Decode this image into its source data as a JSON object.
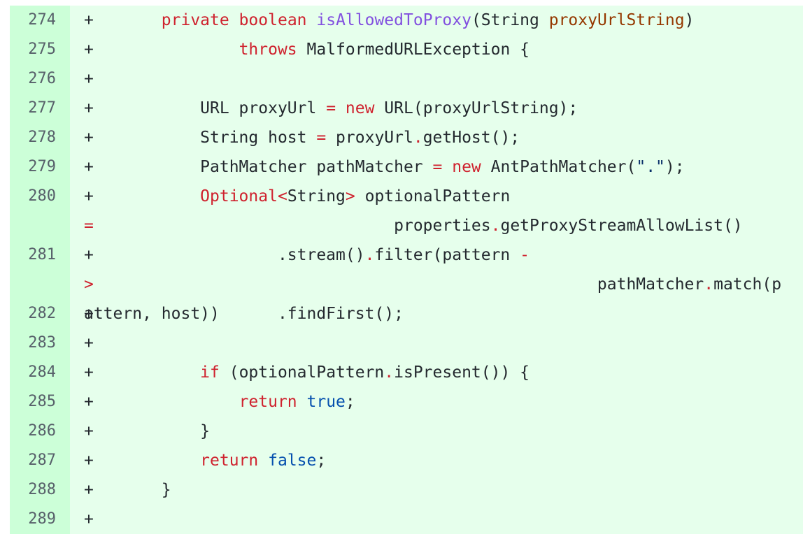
{
  "diff": {
    "marker": "+",
    "colors": {
      "added_bg": "#e6ffec",
      "added_gutter_bg": "#ccffd8",
      "keyword": "#cf222e",
      "function": "#8250df",
      "parameter": "#953800",
      "constant": "#0550ae",
      "string": "#0a3069"
    },
    "lines": [
      {
        "num": "274",
        "tokens": [
          {
            "t": "      ",
            "c": ""
          },
          {
            "t": "private",
            "c": "kw"
          },
          {
            "t": " ",
            "c": ""
          },
          {
            "t": "boolean",
            "c": "kw"
          },
          {
            "t": " ",
            "c": ""
          },
          {
            "t": "isAllowedToProxy",
            "c": "fn"
          },
          {
            "t": "(String ",
            "c": ""
          },
          {
            "t": "proxyUrlString",
            "c": "param"
          },
          {
            "t": ")",
            "c": ""
          }
        ]
      },
      {
        "num": "275",
        "tokens": [
          {
            "t": "              ",
            "c": ""
          },
          {
            "t": "throws",
            "c": "kw"
          },
          {
            "t": " MalformedURLException {",
            "c": ""
          }
        ]
      },
      {
        "num": "276",
        "tokens": []
      },
      {
        "num": "277",
        "tokens": [
          {
            "t": "          URL proxyUrl ",
            "c": ""
          },
          {
            "t": "=",
            "c": "op"
          },
          {
            "t": " ",
            "c": ""
          },
          {
            "t": "new",
            "c": "kw"
          },
          {
            "t": " URL(proxyUrlString);",
            "c": ""
          }
        ]
      },
      {
        "num": "278",
        "tokens": [
          {
            "t": "          String host ",
            "c": ""
          },
          {
            "t": "=",
            "c": "op"
          },
          {
            "t": " proxyUrl",
            "c": ""
          },
          {
            "t": ".",
            "c": "op"
          },
          {
            "t": "getHost();",
            "c": ""
          }
        ]
      },
      {
        "num": "279",
        "tokens": [
          {
            "t": "          PathMatcher pathMatcher ",
            "c": ""
          },
          {
            "t": "=",
            "c": "op"
          },
          {
            "t": " ",
            "c": ""
          },
          {
            "t": "new",
            "c": "kw"
          },
          {
            "t": " AntPathMatcher(",
            "c": ""
          },
          {
            "t": "\".\"",
            "c": "str"
          },
          {
            "t": ");",
            "c": ""
          }
        ]
      },
      {
        "num": "280",
        "wrap": true,
        "tokens": [
          {
            "t": "          ",
            "c": ""
          },
          {
            "t": "Optional",
            "c": "kw"
          },
          {
            "t": "<",
            "c": "op"
          },
          {
            "t": "String",
            "c": ""
          },
          {
            "t": ">",
            "c": "op"
          },
          {
            "t": " optionalPattern ",
            "c": ""
          },
          {
            "t": "=",
            "c": "op"
          },
          {
            "t": "                               ",
            "c": ""
          },
          {
            "t": "properties",
            "c": ""
          },
          {
            "t": ".",
            "c": "op"
          },
          {
            "t": "getProxyStreamAllowList()",
            "c": ""
          }
        ]
      },
      {
        "num": "281",
        "wrap": true,
        "tokens": [
          {
            "t": "                  .stream()",
            "c": ""
          },
          {
            "t": ".",
            "c": "op"
          },
          {
            "t": "filter(pattern ",
            "c": ""
          },
          {
            "t": "->",
            "c": "op"
          },
          {
            "t": "                                                    ",
            "c": ""
          },
          {
            "t": "pathMatcher",
            "c": ""
          },
          {
            "t": ".",
            "c": "op"
          },
          {
            "t": "match(pattern, host))",
            "c": ""
          }
        ]
      },
      {
        "num": "282",
        "tokens": [
          {
            "t": "                  .findFirst();",
            "c": ""
          }
        ]
      },
      {
        "num": "283",
        "tokens": []
      },
      {
        "num": "284",
        "tokens": [
          {
            "t": "          ",
            "c": ""
          },
          {
            "t": "if",
            "c": "kw"
          },
          {
            "t": " (optionalPattern",
            "c": ""
          },
          {
            "t": ".",
            "c": "op"
          },
          {
            "t": "isPresent()) {",
            "c": ""
          }
        ]
      },
      {
        "num": "285",
        "tokens": [
          {
            "t": "              ",
            "c": ""
          },
          {
            "t": "return",
            "c": "kw"
          },
          {
            "t": " ",
            "c": ""
          },
          {
            "t": "true",
            "c": "const"
          },
          {
            "t": ";",
            "c": ""
          }
        ]
      },
      {
        "num": "286",
        "tokens": [
          {
            "t": "          }",
            "c": ""
          }
        ]
      },
      {
        "num": "287",
        "tokens": [
          {
            "t": "          ",
            "c": ""
          },
          {
            "t": "return",
            "c": "kw"
          },
          {
            "t": " ",
            "c": ""
          },
          {
            "t": "false",
            "c": "const"
          },
          {
            "t": ";",
            "c": ""
          }
        ]
      },
      {
        "num": "288",
        "tokens": [
          {
            "t": "      }",
            "c": ""
          }
        ]
      },
      {
        "num": "289",
        "tokens": []
      }
    ]
  }
}
